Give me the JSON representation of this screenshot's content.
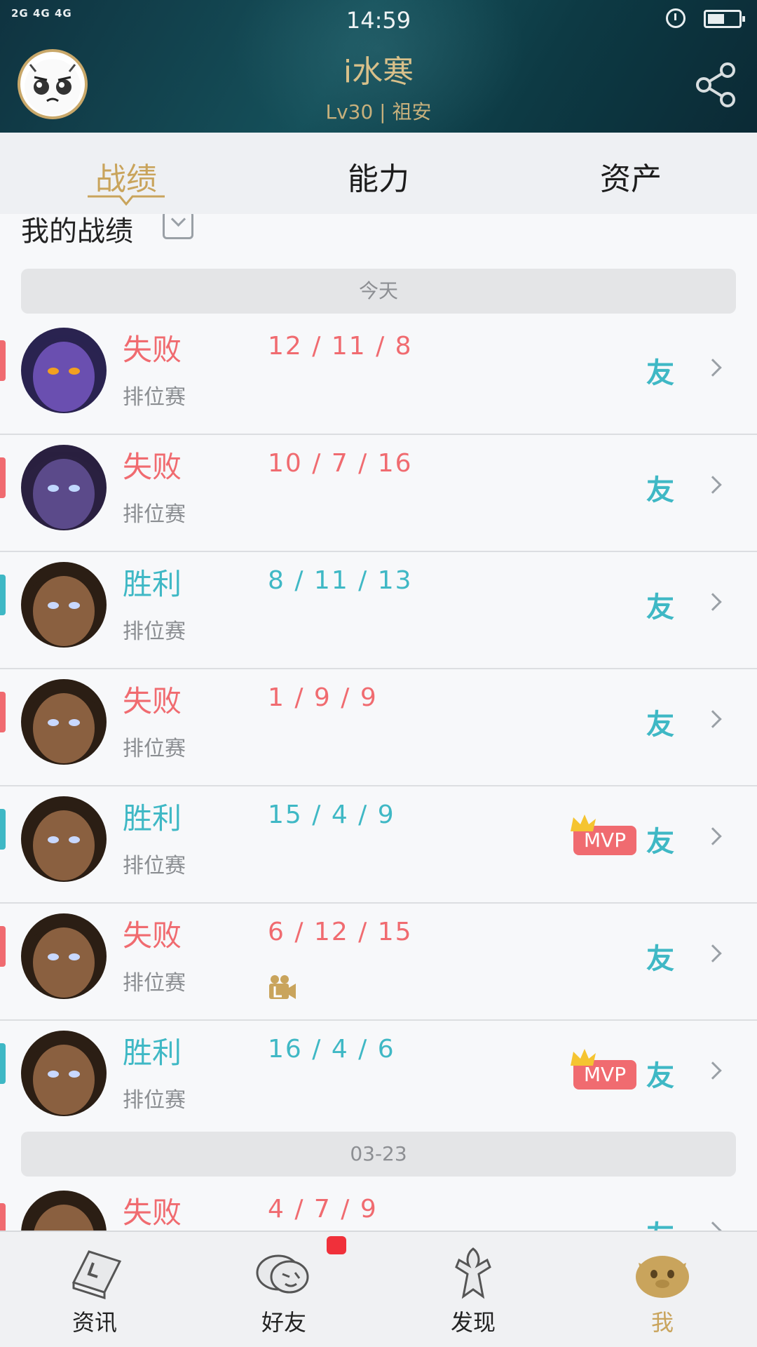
{
  "status_bar": {
    "network": "2G 4G 4G",
    "time": "14:59",
    "battery_level": 0.55
  },
  "header": {
    "username": "i水寒",
    "info": "Lv30 | 祖安"
  },
  "tabs": [
    {
      "label": "战绩",
      "active": true
    },
    {
      "label": "能力",
      "active": false
    },
    {
      "label": "资产",
      "active": false
    }
  ],
  "section": {
    "title": "我的战绩"
  },
  "date_groups": [
    "今天",
    "03-23"
  ],
  "matches": [
    {
      "result": "失败",
      "mode": "排位赛",
      "kda": "12 / 11 / 8",
      "win": false,
      "mvp": false,
      "replay": false,
      "you": "友"
    },
    {
      "result": "失败",
      "mode": "排位赛",
      "kda": "10 / 7 / 16",
      "win": false,
      "mvp": false,
      "replay": false,
      "you": "友"
    },
    {
      "result": "胜利",
      "mode": "排位赛",
      "kda": "8 / 11 / 13",
      "win": true,
      "mvp": false,
      "replay": false,
      "you": "友"
    },
    {
      "result": "失败",
      "mode": "排位赛",
      "kda": "1 / 9 / 9",
      "win": false,
      "mvp": false,
      "replay": false,
      "you": "友"
    },
    {
      "result": "胜利",
      "mode": "排位赛",
      "kda": "15 / 4 / 9",
      "win": true,
      "mvp": true,
      "replay": false,
      "you": "友"
    },
    {
      "result": "失败",
      "mode": "排位赛",
      "kda": "6 / 12 / 15",
      "win": false,
      "mvp": false,
      "replay": true,
      "you": "友"
    },
    {
      "result": "胜利",
      "mode": "排位赛",
      "kda": "16 / 4 / 6",
      "win": true,
      "mvp": true,
      "replay": false,
      "you": "友"
    },
    {
      "result": "失败",
      "mode": "",
      "kda": "4 / 7 / 9",
      "win": false,
      "mvp": false,
      "replay": false,
      "you": "友"
    }
  ],
  "mvp_label": "MVP",
  "bottom_nav": [
    {
      "label": "资讯",
      "icon": "news-icon",
      "active": false
    },
    {
      "label": "好友",
      "icon": "chat-icon",
      "active": false,
      "badge": true
    },
    {
      "label": "发现",
      "icon": "discover-icon",
      "active": false
    },
    {
      "label": "我",
      "icon": "me-icon",
      "active": true
    }
  ],
  "colors": {
    "accent_gold": "#c9a45c",
    "lose": "#f06b70",
    "win": "#3fb8c5",
    "header_bg": "#15505a"
  }
}
